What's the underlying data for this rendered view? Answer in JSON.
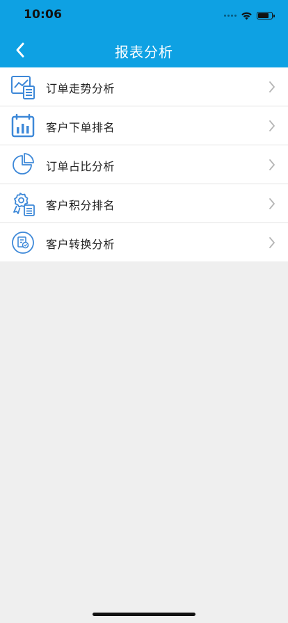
{
  "status_bar": {
    "time": "10:06"
  },
  "nav": {
    "title": "报表分析"
  },
  "menu": {
    "items": [
      {
        "label": "订单走势分析",
        "icon": "trend-report-icon"
      },
      {
        "label": "客户下单排名",
        "icon": "calendar-chart-icon"
      },
      {
        "label": "订单占比分析",
        "icon": "pie-chart-icon"
      },
      {
        "label": "客户积分排名",
        "icon": "badge-report-icon"
      },
      {
        "label": "客户转换分析",
        "icon": "convert-icon"
      }
    ]
  },
  "colors": {
    "primary": "#0ea1e3",
    "icon_blue": "#3d88d8",
    "background": "#efefef"
  }
}
